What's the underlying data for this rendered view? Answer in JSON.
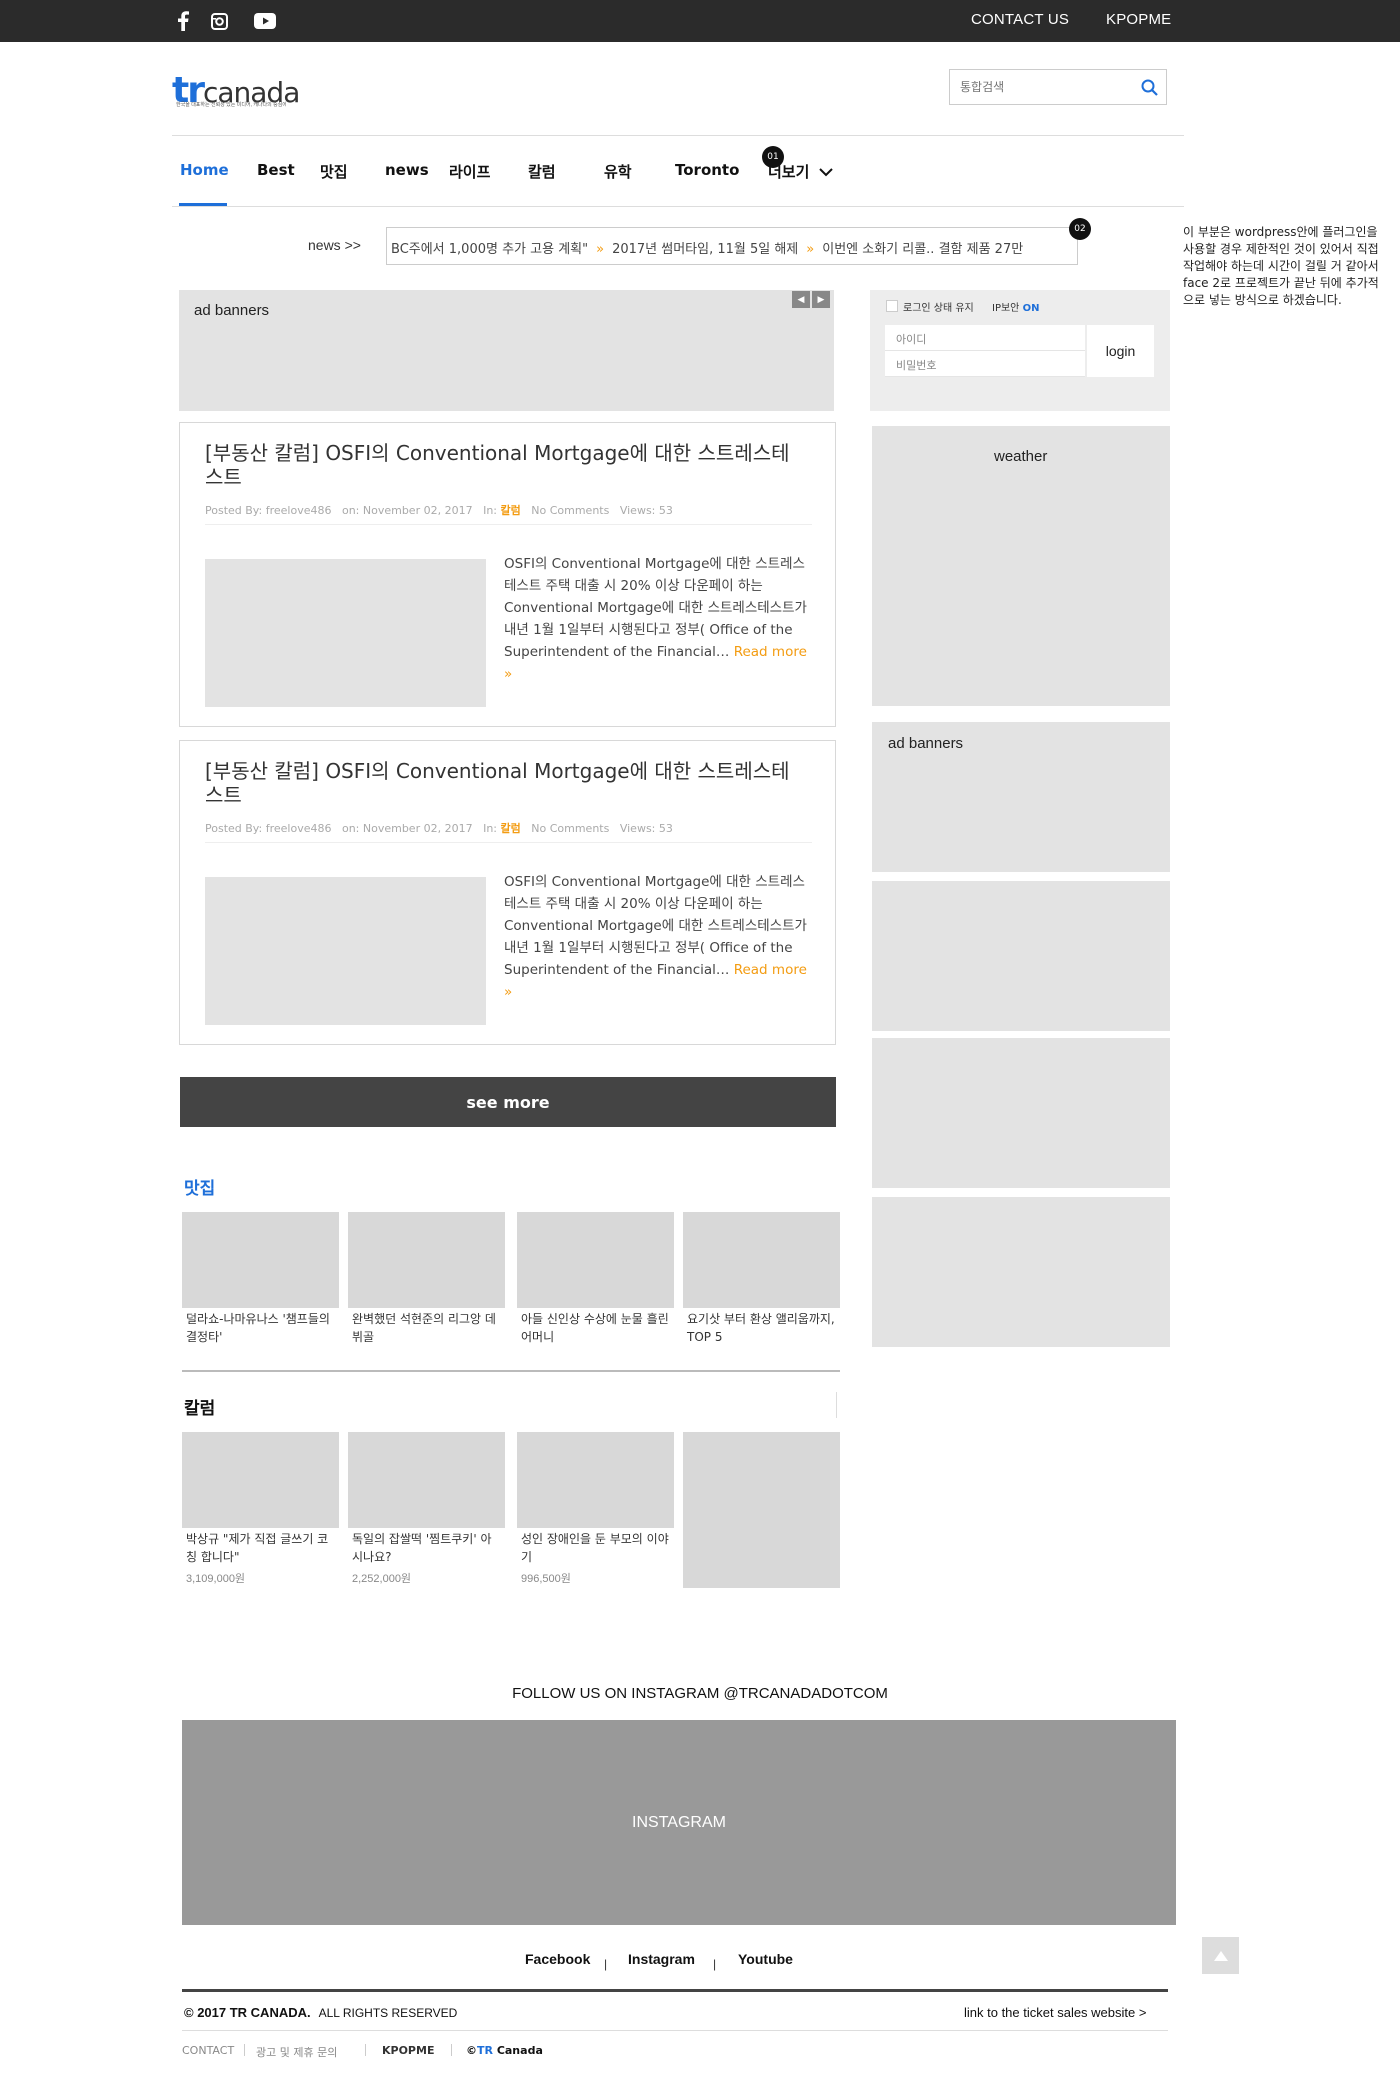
{
  "topbar": {
    "social": [
      "facebook-icon",
      "instagram-icon",
      "youtube-icon"
    ],
    "contact": "CONTACT US",
    "kpopme": "KPOPME"
  },
  "header": {
    "logo_tr": "tr",
    "logo_canada": "canada",
    "logo_tagline": "한국을 대표하는 신뢰성 있는 미디어, 캐나다의 중심에서",
    "search_placeholder": "통합검색"
  },
  "nav": {
    "items": [
      "Home",
      "Best",
      "맛집",
      "news",
      "라이프",
      "칼럼",
      "유학",
      "Toronto",
      "더보기"
    ],
    "badge1": "01",
    "badge2": "02"
  },
  "ticker": {
    "label": "news >>",
    "items": [
      "BC주에서 1,000명 추가 고용 계획\"",
      "2017년 썸머타임, 11월 5일 해제",
      "이번엔 소화기 리콜.. 결함 제품 27만"
    ]
  },
  "side_note": "이 부분은 wordpress안에 플러그인을 사용할 경우 제한적인 것이 있어서 직접 작업해야 하는데 시간이 걸릴 거 같아서 face 2로 프로젝트가 끝난 뒤에 추가적으로 넣는 방식으로 하겠습니다.",
  "ad_top": {
    "label": "ad banners",
    "prev": "◀",
    "next": "▶"
  },
  "login": {
    "keep": "로그인 상태 유지",
    "ip": "IP보안",
    "on": "ON",
    "id_placeholder": "아이디",
    "pw_placeholder": "비밀번호",
    "button": "login"
  },
  "articles": [
    {
      "title": "[부동산 칼럼] OSFI의 Conventional Mortgage에 대한 스트레스테스트",
      "meta_author": "Posted By: freelove486",
      "meta_date": "on: November 02, 2017",
      "meta_in": "In:",
      "meta_cat": "칼럼",
      "meta_comments": "No Comments",
      "meta_views": "Views: 53",
      "excerpt": "OSFI의 Conventional Mortgage에 대한 스트레스테스트 주택 대출 시 20% 이상 다운페이 하는 Conventional Mortgage에 대한 스트레스테스트가 내년 1월 1일부터 시행된다고 정부( Office of the Superintendent of the Financial…",
      "read_more": "Read more »"
    },
    {
      "title": "[부동산 칼럼] OSFI의 Conventional Mortgage에 대한 스트레스테스트",
      "meta_author": "Posted By: freelove486",
      "meta_date": "on: November 02, 2017",
      "meta_in": "In:",
      "meta_cat": "칼럼",
      "meta_comments": "No Comments",
      "meta_views": "Views: 53",
      "excerpt": "OSFI의 Conventional Mortgage에 대한 스트레스테스트 주택 대출 시 20% 이상 다운페이 하는 Conventional Mortgage에 대한 스트레스테스트가 내년 1월 1일부터 시행된다고 정부( Office of the Superintendent of the Financial…",
      "read_more": "Read more »"
    }
  ],
  "see_more": "see more",
  "side": {
    "weather": "weather",
    "ad": "ad banners"
  },
  "matjip": {
    "title": "맛집",
    "cards": [
      "덜라쇼-나마유나스 '챔프들의 결정타'",
      "완벽했던 석현준의 리그앙 데뷔골",
      "아들 신인상 수상에 눈물 흘린 어머니",
      "요기삿 부터 환상 앨리웁까지, TOP 5"
    ]
  },
  "column": {
    "title": "칼럼",
    "cards": [
      {
        "text": "박상규 \"제가 직접 글쓰기 코칭 합니다\"",
        "price": "3,109,000원"
      },
      {
        "text": "독일의 잡쌀떡 '찜트쿠키' 아시나요?",
        "price": "2,252,000원"
      },
      {
        "text": "성인 장애인을 둔 부모의 이야기",
        "price": "996,500원"
      }
    ]
  },
  "instagram": {
    "title": "FOLLOW US ON INSTAGRAM @TRCANADADOTCOM",
    "label": "INSTAGRAM"
  },
  "footer": {
    "links": [
      "Facebook",
      "Instagram",
      "Youtube"
    ],
    "sep": "|",
    "copyright_bold": "© 2017 TR CANADA.",
    "copyright_rest": "ALL RIGHTS RESERVED",
    "ticket": "link to the ticket sales website >",
    "contact": "CONTACT",
    "ad": "광고 및 제휴 문의",
    "kpopme": "KPOPME",
    "brand_c": "©",
    "brand_tr": "TR",
    "brand_canada": " Canada"
  },
  "colors": {
    "accent": "#1e6fd9",
    "orange": "#f39c12",
    "dark": "#2b2b2b"
  }
}
